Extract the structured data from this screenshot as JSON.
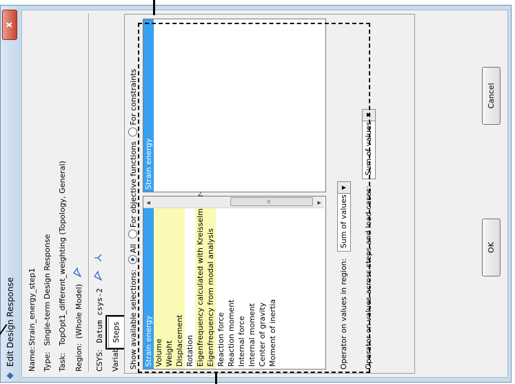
{
  "window": {
    "title": "Edit Design Response",
    "close_label": "x"
  },
  "fields": {
    "name_label": "Name:",
    "name_value": "Strain_energy_step1",
    "type_label": "Type:",
    "type_value": "Single-term Design Response",
    "task_label": "Task:",
    "task_value": "TopOpt1_different_weighting (Topology, General)",
    "region_label": "Region:",
    "region_value": "(Whole Model)",
    "csys_label": "CSYS:",
    "csys_value": "Datum csys-2"
  },
  "tabs": [
    {
      "label": "Variable"
    },
    {
      "label": "Steps"
    }
  ],
  "selections": {
    "prompt": "Show available selections:",
    "options": [
      {
        "label": "All",
        "checked": true
      },
      {
        "label": "For objective functions",
        "checked": false
      },
      {
        "label": "For constraints",
        "checked": false
      }
    ]
  },
  "variable_list": [
    {
      "label": "Strain energy",
      "state": "selected"
    },
    {
      "label": "Volume",
      "state": "highlighted"
    },
    {
      "label": "Weight",
      "state": "highlighted"
    },
    {
      "label": "Displacement",
      "state": "highlighted"
    },
    {
      "label": "Rotation",
      "state": "normal"
    },
    {
      "label": "Eigenfrequency calculated with Kreisselmeier-Steinhauser",
      "state": "highlighted"
    },
    {
      "label": "Eigenfrequency from modal analysis",
      "state": "highlighted"
    },
    {
      "label": "Reaction force",
      "state": "normal"
    },
    {
      "label": "Reaction moment",
      "state": "normal"
    },
    {
      "label": "Internal force",
      "state": "normal"
    },
    {
      "label": "Internal moment",
      "state": "normal"
    },
    {
      "label": "Center of gravity",
      "state": "normal"
    },
    {
      "label": "Moment of inertia",
      "state": "normal"
    }
  ],
  "selected_list": [
    {
      "label": "Strain energy"
    }
  ],
  "scroll_grip": "III",
  "operators": {
    "region_label": "Operator on values in region:",
    "region_value": "Sum of values",
    "steps_label": "Operator on values across steps and load cases:",
    "steps_value": "Sum of values"
  },
  "buttons": {
    "ok": "OK",
    "cancel": "Cancel"
  },
  "colors": {
    "selection": "#38a0f0",
    "highlight": "#fafab4",
    "close": "#c94530"
  }
}
